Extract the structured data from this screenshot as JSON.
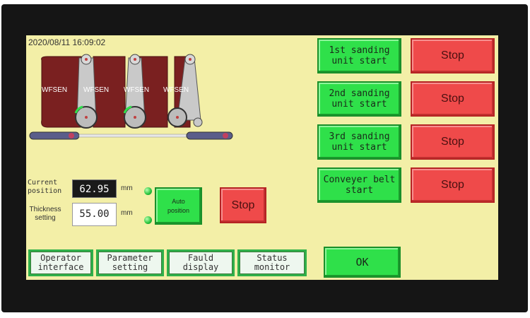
{
  "clock": "2020/08/11 16:09:02",
  "machine": {
    "brand_labels": [
      "WFSEN",
      "WFSEN",
      "WFSEN",
      "WFSEN"
    ]
  },
  "units": [
    {
      "start_label": "1st sanding\nunit start",
      "stop_label": "Stop"
    },
    {
      "start_label": "2nd sanding\nunit start",
      "stop_label": "Stop"
    },
    {
      "start_label": "3rd sanding\nunit start",
      "stop_label": "Stop"
    },
    {
      "start_label": "Conveyer belt\nstart",
      "stop_label": "Stop"
    }
  ],
  "position": {
    "current_label": "Current\nposition",
    "current_value": "62.95",
    "thickness_label": "Thickness\nsetting",
    "thickness_value": "55.00",
    "unit": "mm",
    "auto_label": "Auto\nposition",
    "stop_label": "Stop"
  },
  "tabs": [
    {
      "label": "Operator\ninterface"
    },
    {
      "label": "Parameter\nsetting"
    },
    {
      "label": "Fauld\ndisplay"
    },
    {
      "label": "Status\nmonitor"
    }
  ],
  "ok_label": "OK",
  "colors": {
    "screen_bg": "#f3efa7",
    "green": "#2fe04a",
    "red": "#ef4a4a",
    "belt": "#7a2020"
  }
}
